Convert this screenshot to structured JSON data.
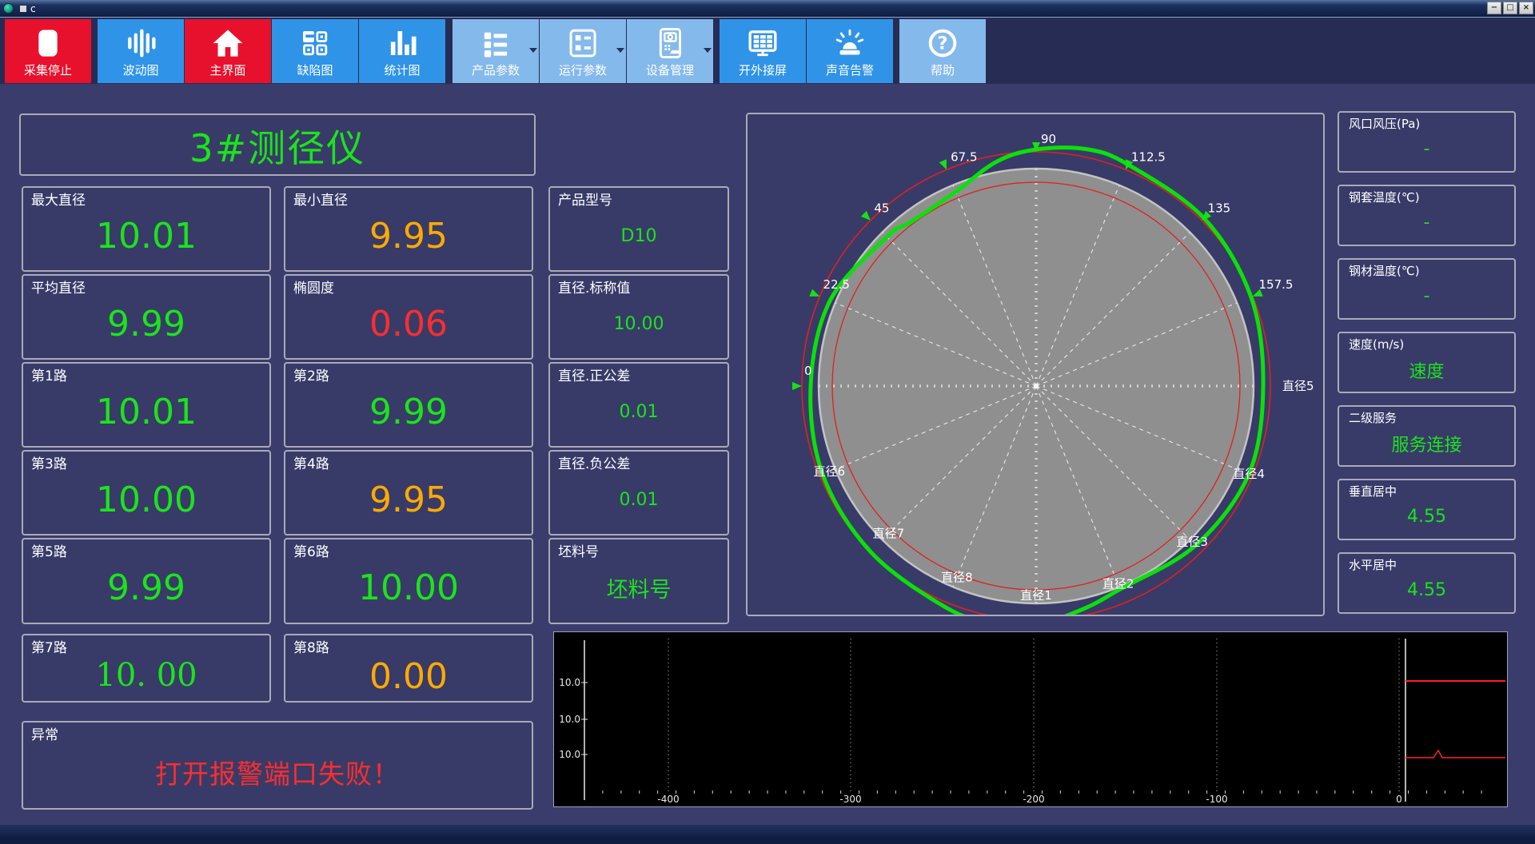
{
  "window": {
    "title": "c"
  },
  "toolbar": [
    {
      "label": "采集停止",
      "style": "red",
      "icon": "stop-icon",
      "dropdown": false
    },
    {
      "label": "波动图",
      "style": "blue",
      "icon": "waveform-icon",
      "dropdown": false
    },
    {
      "label": "主界面",
      "style": "red",
      "icon": "home-icon",
      "dropdown": false
    },
    {
      "label": "缺陷图",
      "style": "blue",
      "icon": "defect-grid-icon",
      "dropdown": false
    },
    {
      "label": "统计图",
      "style": "blue",
      "icon": "bar-chart-icon",
      "dropdown": false
    },
    {
      "label": "产品参数",
      "style": "light",
      "icon": "product-params-icon",
      "dropdown": true
    },
    {
      "label": "运行参数",
      "style": "light",
      "icon": "run-params-icon",
      "dropdown": true
    },
    {
      "label": "设备管理",
      "style": "light",
      "icon": "device-manage-icon",
      "dropdown": true
    },
    {
      "label": "开外接屏",
      "style": "blue",
      "icon": "external-screen-icon",
      "dropdown": false
    },
    {
      "label": "声音告警",
      "style": "blue",
      "icon": "siren-icon",
      "dropdown": false
    },
    {
      "label": "帮助",
      "style": "light",
      "icon": "help-icon",
      "dropdown": false
    }
  ],
  "device_title": "3#测径仪",
  "metric_cells": [
    {
      "row": 0,
      "col": 0,
      "label": "最大直径",
      "value": "10.01",
      "color": "green",
      "size": "big"
    },
    {
      "row": 0,
      "col": 1,
      "label": "最小直径",
      "value": "9.95",
      "color": "orange",
      "size": "big"
    },
    {
      "row": 0,
      "col": 2,
      "label": "产品型号",
      "value": "D10",
      "color": "green",
      "size": "small"
    },
    {
      "row": 1,
      "col": 0,
      "label": "平均直径",
      "value": "9.99",
      "color": "green",
      "size": "big"
    },
    {
      "row": 1,
      "col": 1,
      "label": "椭圆度",
      "value": "0.06",
      "color": "red",
      "size": "big"
    },
    {
      "row": 1,
      "col": 2,
      "label": "直径.标称值",
      "value": "10.00",
      "color": "green",
      "size": "small"
    },
    {
      "row": 2,
      "col": 0,
      "label": "第1路",
      "value": "10.01",
      "color": "green",
      "size": "big"
    },
    {
      "row": 2,
      "col": 1,
      "label": "第2路",
      "value": "9.99",
      "color": "green",
      "size": "big"
    },
    {
      "row": 2,
      "col": 2,
      "label": "直径.正公差",
      "value": "0.01",
      "color": "green",
      "size": "small"
    },
    {
      "row": 3,
      "col": 0,
      "label": "第3路",
      "value": "10.00",
      "color": "green",
      "size": "big"
    },
    {
      "row": 3,
      "col": 1,
      "label": "第4路",
      "value": "9.95",
      "color": "orange",
      "size": "big"
    },
    {
      "row": 3,
      "col": 2,
      "label": "直径.负公差",
      "value": "0.01",
      "color": "green",
      "size": "small"
    },
    {
      "row": 4,
      "col": 0,
      "label": "第5路",
      "value": "9.99",
      "color": "green",
      "size": "big"
    },
    {
      "row": 4,
      "col": 1,
      "label": "第6路",
      "value": "10.00",
      "color": "green",
      "size": "big"
    },
    {
      "row": 4,
      "col": 2,
      "label": "坯料号",
      "value": "坯料号",
      "color": "green",
      "size": "medium"
    },
    {
      "row": 5,
      "col": 0,
      "label": "第7路",
      "value": "10. 00",
      "color": "green",
      "size": "big",
      "serif": true
    },
    {
      "row": 5,
      "col": 1,
      "label": "第8路",
      "value": "0.00",
      "color": "orange",
      "size": "big"
    }
  ],
  "alarm": {
    "label": "异常",
    "value": "打开报警端口失败！"
  },
  "right_panel": [
    {
      "label": "风口风压(Pa)",
      "value": "-"
    },
    {
      "label": "钢套温度(℃)",
      "value": "-"
    },
    {
      "label": "钢材温度(℃)",
      "value": "-"
    },
    {
      "label": "速度(m/s)",
      "value": "速度"
    },
    {
      "label": "二级服务",
      "value": "服务连接"
    },
    {
      "label": "垂直居中",
      "value": "4.55"
    },
    {
      "label": "水平居中",
      "value": "4.55"
    }
  ],
  "chart_data": [
    {
      "type": "polar-profile",
      "title": "cross-section profile",
      "angle_labels": [
        {
          "text": "0",
          "deg": 180
        },
        {
          "text": "22.5",
          "deg": 157.5
        },
        {
          "text": "45",
          "deg": 135
        },
        {
          "text": "67.5",
          "deg": 112.5
        },
        {
          "text": "90",
          "deg": 90
        },
        {
          "text": "112.5",
          "deg": 67.5
        },
        {
          "text": "135",
          "deg": 45
        },
        {
          "text": "157.5",
          "deg": 22.5
        }
      ],
      "diameter_labels": [
        {
          "text": "直径1",
          "deg": 270
        },
        {
          "text": "直径2",
          "deg": 292.5
        },
        {
          "text": "直径3",
          "deg": 315
        },
        {
          "text": "直径4",
          "deg": 337.5
        },
        {
          "text": "直径5",
          "deg": 0
        },
        {
          "text": "直径6",
          "deg": 202.5
        },
        {
          "text": "直径7",
          "deg": 225
        },
        {
          "text": "直径8",
          "deg": 247.5
        }
      ],
      "body_radius": 272,
      "tolerance_inner_radius": 255,
      "tolerance_outer_radius": 293,
      "profile_points_deg_r": [
        [
          0,
          284
        ],
        [
          22.5,
          291
        ],
        [
          45,
          297
        ],
        [
          67.5,
          300
        ],
        [
          78,
          303
        ],
        [
          90,
          296
        ],
        [
          100,
          285
        ],
        [
          112.5,
          263
        ],
        [
          127,
          258
        ],
        [
          135,
          264
        ],
        [
          157.5,
          279
        ],
        [
          180,
          282
        ],
        [
          202.5,
          289
        ],
        [
          225,
          293
        ],
        [
          247.5,
          299
        ],
        [
          260,
          303
        ],
        [
          270,
          299
        ],
        [
          282,
          285
        ],
        [
          292.5,
          275
        ],
        [
          315,
          282
        ],
        [
          337.5,
          288
        ]
      ],
      "colors": {
        "profile": "#0be00b",
        "tolerance": "#e02020",
        "body": "#8f8f8f"
      }
    },
    {
      "type": "line",
      "title": "diameter trend",
      "y_ticks": [
        "10.0",
        "10.0",
        "10.0"
      ],
      "x_ticks": [
        "-400",
        "-300",
        "-200",
        "-100",
        "0"
      ],
      "series_color": "#ff2020",
      "grid": "dotted-vertical",
      "background": "#000000"
    }
  ],
  "colors": {
    "green": "#1be41b",
    "orange": "#ffaa00",
    "red": "#ff2d2d",
    "accent_red": "#e8112d",
    "accent_blue": "#2f93e8",
    "accent_light": "#84b9ec"
  }
}
